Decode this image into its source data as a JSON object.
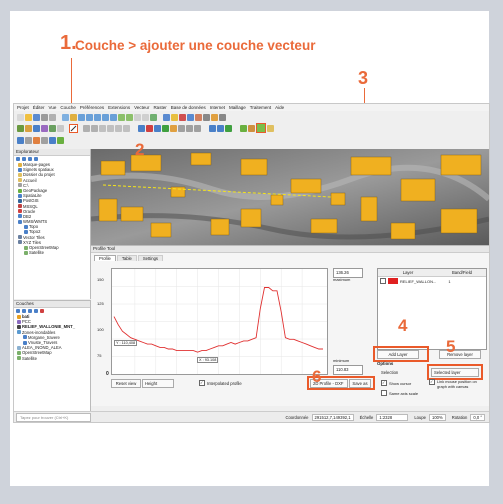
{
  "callout": {
    "num": "1.",
    "text": "Couche > ajouter une couche vecteur"
  },
  "steps": {
    "s2": "2",
    "s3": "3",
    "s4": "4",
    "s5": "5",
    "s6": "6"
  },
  "menu": [
    "Projet",
    "Éditer",
    "Vue",
    "Couche",
    "Préférences",
    "Extensions",
    "Vecteur",
    "Raster",
    "Base de données",
    "Internet",
    "Maillage",
    "Traitement",
    "Aide"
  ],
  "explorer": {
    "title": "Explorateur",
    "items": [
      "Marque-pages",
      "Signets spatiaux",
      "Dossier du projet",
      "Accueil",
      "C:\\",
      "GeoPackage",
      "SpatiaLite",
      "PostGIS",
      "MSSQL",
      "Oracle",
      "DB2",
      "WMS/WMTS",
      "Topo",
      "Topo2",
      "Vector Tiles",
      "XYZ Tiles",
      "OpenStreetMap",
      "Satellite"
    ]
  },
  "layers_panel": {
    "title": "Couches",
    "items": [
      "bati",
      "PCC",
      "RELIEF_WALLONIE_MNT_",
      "Zones-inondables",
      "Morgane_travere",
      "Vnuste_Travers",
      "ALEA_INOND_ALEA",
      "OpenStreetMap",
      "Satellite"
    ]
  },
  "profile_tool": {
    "title": "Profile Tool",
    "tabs": [
      "Profile",
      "Table",
      "Settings"
    ],
    "y_labels": [
      "150",
      "125",
      "100",
      "75"
    ],
    "x_label": "0",
    "readout_left": "Y : 110,408",
    "readout_right": "X : 93.108",
    "max_value": "136.26",
    "max_label": "maximum",
    "min_value": "110.83",
    "min_label": "minimum",
    "reset_label": "Reset view",
    "height_select": "Height",
    "interpolated": "Interpolated profile",
    "export_select": "2D Profile - DXF",
    "save_label": "Save as",
    "layer_header": "Layer",
    "band_header": "Band/Field",
    "row_layer": "RELIEF_WALLON...",
    "row_band": "1",
    "add_layer": "Add Layer",
    "remove_layer": "Remove layer",
    "options": "Options",
    "selection_label": "Selection",
    "selection_value": "Selected layer",
    "show_cursor": "Show cursor",
    "link_mouse": "Link mouse position on graph with canvas",
    "same_axis": "Same axis scale"
  },
  "status": {
    "search_placeholder": "Tapez pour trouver (Ctrl+K)",
    "coord_label": "Coordonnée",
    "coord_value": "291512,7,149392,1",
    "scale_label": "Échelle",
    "scale_value": "1:2328",
    "loupe_label": "Loupe",
    "loupe_value": "100%",
    "rotation_label": "Rotation",
    "rotation_value": "0,0 °"
  },
  "chart_data": {
    "type": "line",
    "x": [
      0,
      2,
      4,
      6,
      8,
      10,
      12,
      14,
      16,
      18,
      20,
      22,
      24,
      26,
      28,
      30,
      32,
      34,
      36,
      38,
      40,
      42,
      44,
      46,
      48,
      50,
      52,
      54,
      56,
      58,
      60,
      62,
      64,
      66,
      68,
      70,
      72,
      74,
      76,
      78,
      80,
      82,
      84,
      86,
      88,
      90,
      92,
      94,
      96,
      98,
      100
    ],
    "series": [
      {
        "values": [
          133,
          128,
          124,
          122,
          120,
          119,
          118,
          117,
          116,
          116,
          115,
          114,
          114,
          113,
          113,
          112,
          112,
          112,
          112,
          112,
          111,
          112,
          112,
          113,
          114,
          115,
          115,
          116,
          117,
          116,
          117,
          118,
          118,
          119,
          120,
          138,
          151,
          151,
          149,
          149,
          136,
          120,
          119,
          119,
          118,
          117,
          116,
          115,
          114,
          113,
          113
        ]
      }
    ],
    "ylim": [
      100,
      160
    ]
  }
}
